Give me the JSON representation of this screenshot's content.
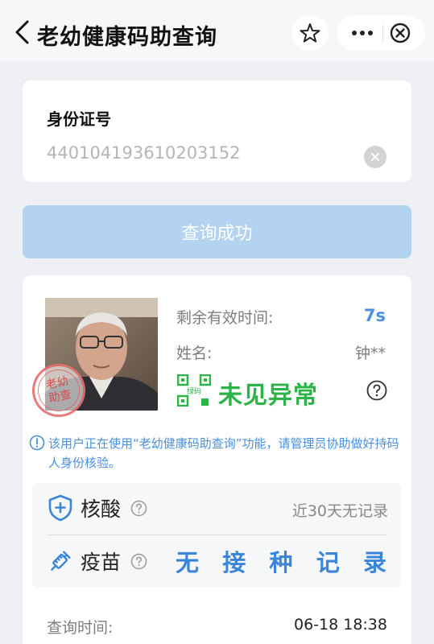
{
  "navbar": {
    "title": "老幼健康码助查询",
    "icons": [
      "back-icon",
      "star-icon",
      "more-icon",
      "close-icon"
    ]
  },
  "id_section": {
    "label": "身份证号",
    "value": "440104193610203152"
  },
  "query_button": {
    "label": "查询成功"
  },
  "result": {
    "valid_label": "剩余有效时间:",
    "valid_value": "7s",
    "name_label": "姓名:",
    "name_value": "钟**",
    "code_icon_text": "绿码",
    "status": "未见异常",
    "stamp_line1": "老幼",
    "stamp_line2": "助查",
    "notice": "该用户正在使用“老幼健康码助查询”功能，请管理员协助做好持码人身份核验。",
    "nucleic_label": "核酸",
    "nucleic_value": "近30天无记录",
    "vaccine_label": "疫苗",
    "vaccine_chars": [
      "无",
      "接",
      "种",
      "记",
      "录"
    ],
    "time_label": "查询时间:",
    "time_value": "06-18 18:38"
  },
  "colors": {
    "accent_blue": "#4a8fe0",
    "status_green": "#2cb449",
    "button_disabled_blue": "#b3d3f1",
    "stamp_red": "#d84a4a"
  }
}
